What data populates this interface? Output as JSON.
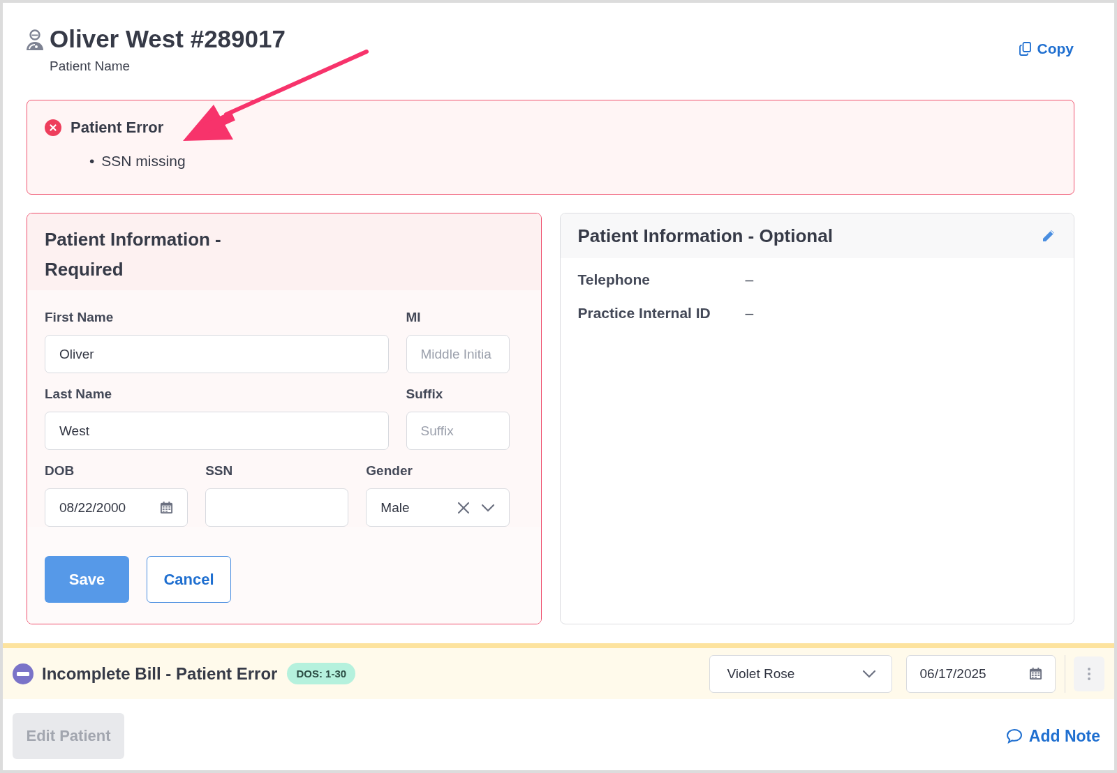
{
  "header": {
    "title": "Oliver West #289017",
    "subtitle": "Patient Name",
    "copy_link": "Copy"
  },
  "error": {
    "title": "Patient Error",
    "bullet": "•",
    "items": [
      "SSN missing"
    ]
  },
  "required_card": {
    "title": "Patient Information - Required",
    "field_rows": [
      [
        {
          "kind": "text",
          "label": "First Name",
          "value": "Oliver"
        },
        {
          "kind": "text",
          "label": "MI",
          "placeholder": "Middle Initia"
        }
      ],
      [
        {
          "kind": "text",
          "label": "Last Name",
          "value": "West"
        },
        {
          "kind": "text",
          "label": "Suffix",
          "placeholder": "Suffix"
        }
      ],
      [
        {
          "kind": "date",
          "label": "DOB",
          "value": "08/22/2000"
        },
        {
          "kind": "text",
          "label": "SSN"
        },
        {
          "kind": "select",
          "label": "Gender",
          "value": "Male"
        }
      ]
    ],
    "buttons": [
      {
        "kind": "primary",
        "label": "Save"
      },
      {
        "kind": "secondary",
        "label": "Cancel"
      }
    ]
  },
  "optional_card": {
    "title": "Patient Information - Optional",
    "rows": [
      {
        "label": "Telephone",
        "value": "–"
      },
      {
        "label": "Practice Internal ID",
        "value": "–"
      }
    ]
  },
  "bill": {
    "title": "Incomplete Bill - Patient Error",
    "badge": "DOS: 1-30",
    "provider": "Violet Rose",
    "date": "06/17/2025"
  },
  "footer": {
    "edit_button": {
      "label": "Edit Patient",
      "disabled": true
    },
    "add_note": "Add Note"
  }
}
